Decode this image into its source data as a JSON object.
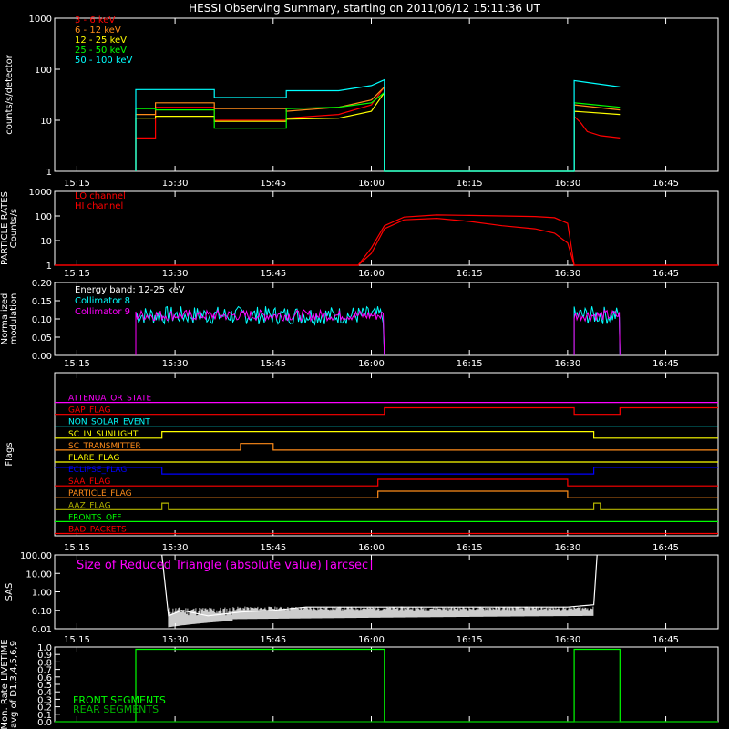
{
  "title": "HESSI Observing Summary, starting on 2011/06/12 15:11:36 UT",
  "time_ticks": [
    "15:15",
    "15:30",
    "15:45",
    "16:00",
    "16:15",
    "16:30",
    "16:45"
  ],
  "colors": {
    "bg": "#000000",
    "axes": "#ffffff",
    "red": "#ff0000",
    "orange": "#ff8c1a",
    "yellow": "#ffff00",
    "green": "#00ff00",
    "cyan": "#00ffff",
    "magenta": "#ff00ff",
    "blue": "#0000ff",
    "dark_yellow": "#b4b400",
    "front_green": "#00ff00",
    "rear_green": "#00b400"
  },
  "chart_data": [
    {
      "id": "count_rates",
      "type": "line",
      "ylabel": "counts/s/detector",
      "ylog": true,
      "ylim": [
        1,
        1000
      ],
      "yticks": [
        "1",
        "10",
        "100",
        "1000"
      ],
      "xlim": [
        "15:11:36",
        "16:53"
      ],
      "series": [
        {
          "name": "3 - 6 keV",
          "color": "#ff0000",
          "x": [
            "15:24",
            "15:24",
            "15:27",
            "15:27",
            "15:36",
            "15:36",
            "15:47",
            "15:47",
            "15:55",
            "16:00",
            "16:02",
            "16:02",
            "16:31",
            "16:31",
            "16:32",
            "16:33",
            "16:35",
            "16:38"
          ],
          "values": [
            1,
            4.5,
            4.5,
            18,
            18,
            10,
            10,
            11,
            13,
            20,
            45,
            1,
            1,
            12,
            9,
            6,
            5,
            4.5
          ]
        },
        {
          "name": "6 - 12 keV",
          "color": "#ff8c1a",
          "x": [
            "15:24",
            "15:24",
            "15:27",
            "15:27",
            "15:36",
            "15:36",
            "15:47",
            "15:47",
            "15:55",
            "16:00",
            "16:02",
            "16:02",
            "16:31",
            "16:31",
            "16:38"
          ],
          "values": [
            1,
            13,
            13,
            22,
            22,
            17,
            17,
            15,
            18,
            25,
            45,
            1,
            1,
            20,
            16
          ]
        },
        {
          "name": "12 - 25 keV",
          "color": "#ffff00",
          "x": [
            "15:24",
            "15:24",
            "15:27",
            "15:27",
            "15:36",
            "15:36",
            "15:47",
            "15:47",
            "15:55",
            "16:00",
            "16:02",
            "16:02",
            "16:31",
            "16:31",
            "16:38"
          ],
          "values": [
            1,
            11,
            11,
            12,
            12,
            9.5,
            9.5,
            10.5,
            11,
            15,
            35,
            1,
            1,
            15,
            13
          ]
        },
        {
          "name": "25 - 50 keV",
          "color": "#00ff00",
          "x": [
            "15:24",
            "15:24",
            "15:27",
            "15:27",
            "15:36",
            "15:36",
            "15:47",
            "15:47",
            "15:55",
            "16:00",
            "16:02",
            "16:02",
            "16:31",
            "16:31",
            "16:38"
          ],
          "values": [
            1,
            17,
            17,
            16,
            16,
            7,
            7,
            17,
            18,
            22,
            35,
            1,
            1,
            22,
            18
          ]
        },
        {
          "name": "50 - 100 keV",
          "color": "#00ffff",
          "x": [
            "15:24",
            "15:24",
            "15:36",
            "15:36",
            "15:47",
            "15:47",
            "15:55",
            "16:00",
            "16:02",
            "16:02",
            "16:31",
            "16:31",
            "16:38"
          ],
          "values": [
            1,
            40,
            40,
            28,
            28,
            38,
            38,
            48,
            62,
            1,
            1,
            60,
            45
          ]
        }
      ]
    },
    {
      "id": "particle_rates",
      "type": "line",
      "ylabel": "PARTICLE RATES Counts/s",
      "ylog": true,
      "ylim": [
        1,
        1000
      ],
      "yticks": [
        "1",
        "10",
        "100",
        "1000"
      ],
      "series": [
        {
          "name": "LO channel",
          "color": "#ff0000",
          "x": [
            "15:11:36",
            "15:58",
            "16:00",
            "16:02",
            "16:05",
            "16:10",
            "16:15",
            "16:20",
            "16:25",
            "16:28",
            "16:30",
            "16:31",
            "16:53"
          ],
          "values": [
            1,
            1,
            5,
            40,
            90,
            110,
            105,
            100,
            95,
            85,
            50,
            1,
            1
          ]
        },
        {
          "name": "HI channel",
          "color": "#ff0000",
          "x": [
            "15:11:36",
            "15:58",
            "16:00",
            "16:02",
            "16:05",
            "16:10",
            "16:15",
            "16:20",
            "16:25",
            "16:28",
            "16:30",
            "16:31",
            "16:53"
          ],
          "values": [
            1,
            1,
            3,
            30,
            70,
            80,
            60,
            40,
            30,
            20,
            8,
            1,
            1
          ]
        }
      ]
    },
    {
      "id": "modulation",
      "type": "line",
      "ylabel": "Normalized modulation",
      "ylim": [
        0,
        0.2
      ],
      "yticks": [
        "0.00",
        "0.05",
        "0.10",
        "0.15",
        "0.20"
      ],
      "annotation": "Energy band: 12-25 keV",
      "series": [
        {
          "name": "Collimator 8",
          "color": "#00ffff",
          "segments": [
            [
              "15:24",
              "16:02"
            ],
            [
              "16:31",
              "16:38"
            ]
          ],
          "mean": 0.11,
          "noise": 0.025
        },
        {
          "name": "Collimator 9",
          "color": "#ff00ff",
          "segments": [
            [
              "15:24",
              "16:02"
            ],
            [
              "16:31",
              "16:38"
            ]
          ],
          "mean": 0.11,
          "noise": 0.015
        }
      ]
    },
    {
      "id": "flags",
      "type": "line",
      "ylabel": "Flags",
      "series": [
        {
          "name": "ATTENUATOR_STATE",
          "color": "#ff00ff",
          "x": [
            "15:11:36",
            "16:53"
          ],
          "values": [
            0,
            0
          ]
        },
        {
          "name": "GAP_FLAG",
          "color": "#ff0000",
          "x": [
            "15:11:36",
            "16:02",
            "16:02",
            "16:31",
            "16:31",
            "16:38",
            "16:38",
            "16:53"
          ],
          "values": [
            0,
            0,
            1,
            1,
            0,
            0,
            1,
            1
          ]
        },
        {
          "name": "NON_SOLAR_EVENT",
          "color": "#00ffff",
          "x": [
            "15:11:36",
            "16:53"
          ],
          "values": [
            0,
            0
          ]
        },
        {
          "name": "SC_IN_SUNLIGHT",
          "color": "#ffff00",
          "x": [
            "15:11:36",
            "15:28",
            "15:28",
            "16:34",
            "16:34",
            "16:53"
          ],
          "values": [
            0,
            0,
            1,
            1,
            0,
            0
          ]
        },
        {
          "name": "SC_TRANSMITTER",
          "color": "#ff8c1a",
          "x": [
            "15:11:36",
            "15:40",
            "15:40",
            "15:45",
            "15:45",
            "16:53"
          ],
          "values": [
            0,
            0,
            1,
            1,
            0,
            0
          ]
        },
        {
          "name": "FLARE_FLAG",
          "color": "#ffff00",
          "x": [
            "15:11:36",
            "16:53"
          ],
          "values": [
            0,
            0
          ]
        },
        {
          "name": "ECLIPSE_FLAG",
          "color": "#0000ff",
          "x": [
            "15:11:36",
            "15:28",
            "15:28",
            "16:34",
            "16:34",
            "16:53"
          ],
          "values": [
            1,
            1,
            0,
            0,
            1,
            1
          ]
        },
        {
          "name": "SAA_FLAG",
          "color": "#ff0000",
          "x": [
            "15:11:36",
            "16:01",
            "16:01",
            "16:30",
            "16:30",
            "16:53"
          ],
          "values": [
            0,
            0,
            1,
            1,
            0,
            0
          ]
        },
        {
          "name": "PARTICLE_FLAG",
          "color": "#ff8c1a",
          "x": [
            "15:11:36",
            "16:01",
            "16:01",
            "16:30",
            "16:30",
            "16:53"
          ],
          "values": [
            0,
            0,
            1,
            1,
            0,
            0
          ]
        },
        {
          "name": "AAZ_FLAG",
          "color": "#b4b400",
          "x": [
            "15:11:36",
            "15:28",
            "15:28",
            "15:29",
            "15:29",
            "16:34",
            "16:34",
            "16:35",
            "16:35",
            "16:53"
          ],
          "values": [
            0,
            0,
            1,
            1,
            0,
            0,
            1,
            1,
            0,
            0
          ]
        },
        {
          "name": "FRONTS_OFF",
          "color": "#00ff00",
          "x": [
            "15:11:36",
            "16:53"
          ],
          "values": [
            0,
            0
          ]
        },
        {
          "name": "BAD_PACKETS",
          "color": "#ff0000",
          "x": [
            "15:11:36",
            "16:53"
          ],
          "values": [
            0,
            0
          ]
        }
      ]
    },
    {
      "id": "sas",
      "type": "line",
      "ylabel": "SAS",
      "ylog": true,
      "ylim": [
        0.01,
        100
      ],
      "yticks": [
        "0.01",
        "0.10",
        "1.00",
        "10.00",
        "100.00"
      ],
      "annotation": "Size of Reduced Triangle (absolute value) [arcsec]",
      "series": [
        {
          "name": "Size of Reduced Triangle",
          "color": "#ffffff",
          "x": [
            "15:28",
            "15:29",
            "15:31",
            "15:35",
            "15:40",
            "15:45",
            "15:50",
            "16:00",
            "16:15",
            "16:30",
            "16:34",
            "16:34.5"
          ],
          "values": [
            100,
            0.05,
            0.1,
            0.05,
            0.08,
            0.1,
            0.15,
            0.15,
            0.15,
            0.15,
            0.2,
            100
          ]
        }
      ]
    },
    {
      "id": "livetime",
      "type": "line",
      "ylabel": "Mon. Rate LIVETIME avg of D1,3,4,5,6,9",
      "ylim": [
        0,
        1
      ],
      "yticks": [
        "0.0",
        "0.1",
        "0.2",
        "0.3",
        "0.4",
        "0.5",
        "0.6",
        "0.7",
        "0.8",
        "0.9",
        "1.0"
      ],
      "series": [
        {
          "name": "FRONT SEGMENTS",
          "color": "#00ff00",
          "x": [
            "15:11:36",
            "15:24",
            "15:24",
            "16:02",
            "16:02",
            "16:31",
            "16:31",
            "16:38",
            "16:38",
            "16:53"
          ],
          "values": [
            0,
            0,
            0.97,
            0.97,
            0,
            0,
            0.97,
            0.97,
            0,
            0
          ]
        },
        {
          "name": "REAR SEGMENTS",
          "color": "#00b400",
          "x": [
            "15:11:36",
            "16:53"
          ],
          "values": [
            0,
            0
          ]
        }
      ]
    }
  ]
}
